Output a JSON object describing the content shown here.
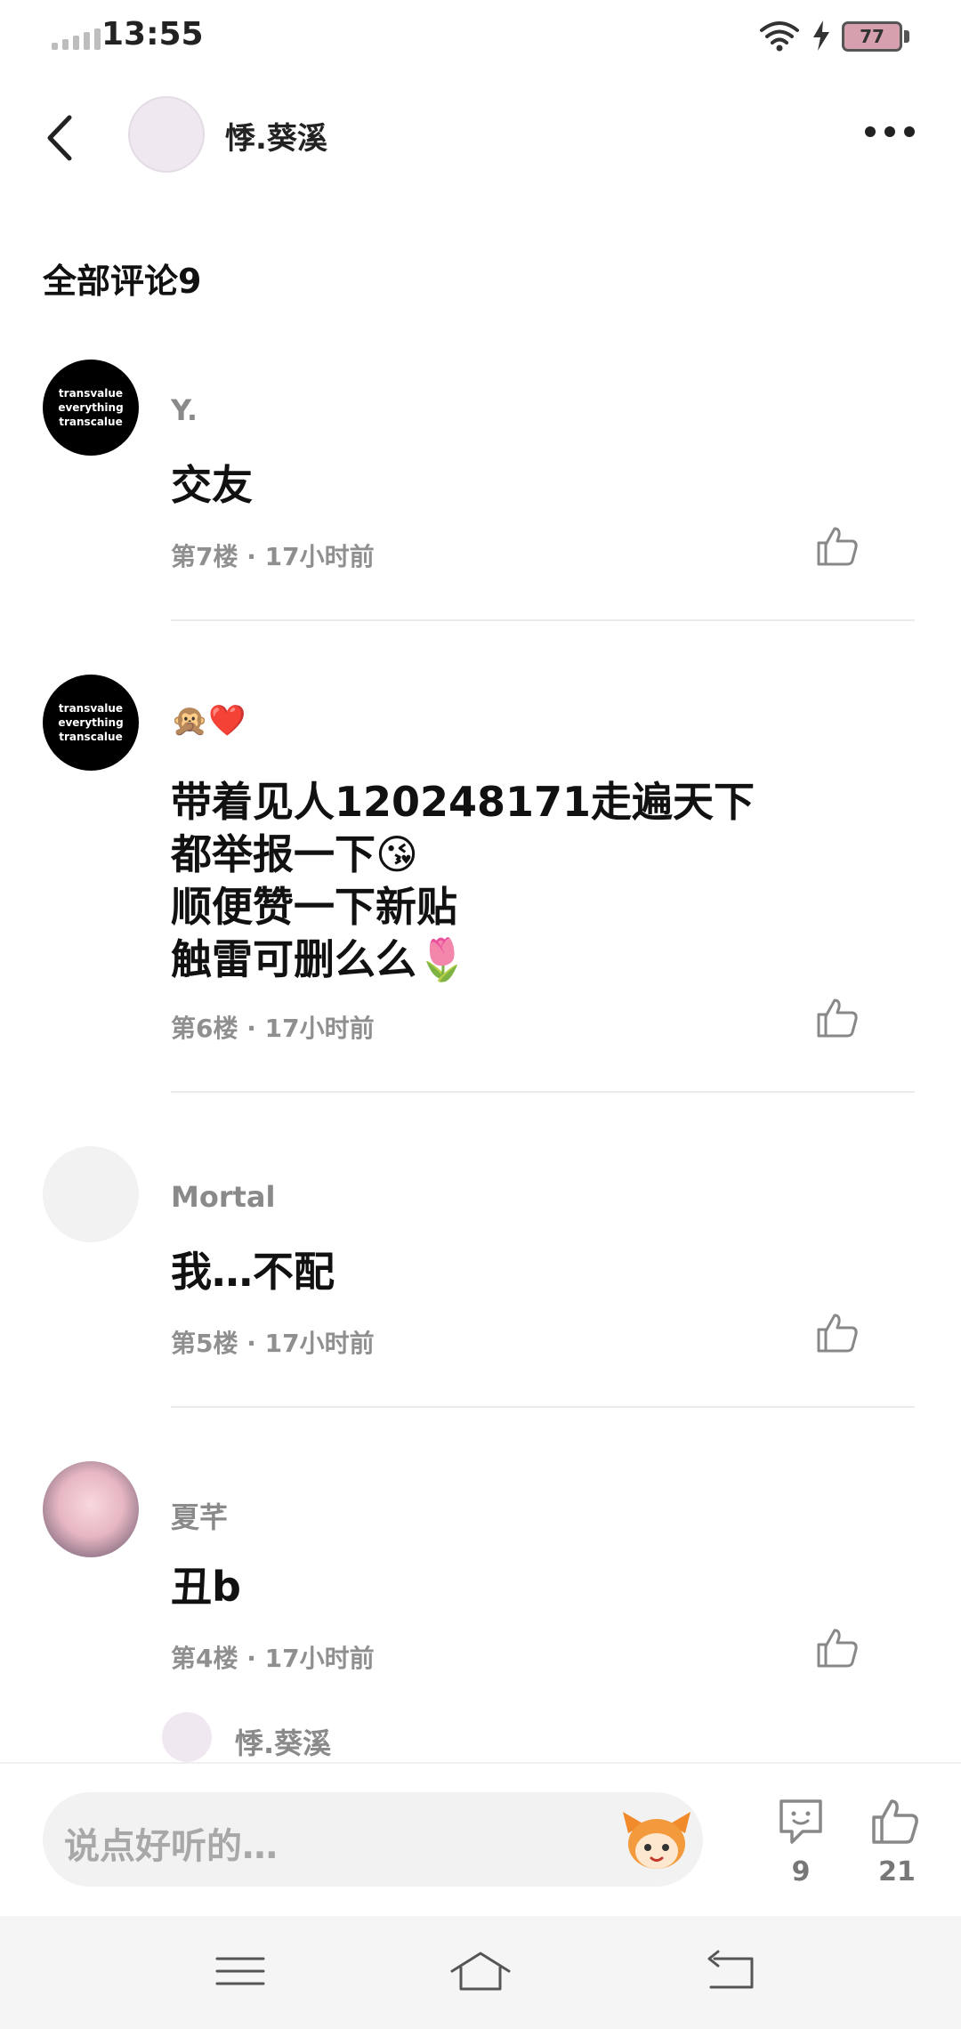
{
  "status_bar": {
    "time": "13:55",
    "battery": "77",
    "colors": {
      "battery_fill": "#d6a0ae"
    }
  },
  "header": {
    "title": "悸.葵溪",
    "back_icon": "chevron-left-icon",
    "more_icon": "more-dots-icon"
  },
  "section": {
    "title": "全部评论9"
  },
  "comments": [
    {
      "username": "Y.",
      "avatar_text": [
        "transvalue",
        "everything",
        "transcalue"
      ],
      "lines": [
        "交友"
      ],
      "meta": "第7楼 · 17小时前"
    },
    {
      "username": "🙊❤️",
      "avatar_text": [
        "transvalue",
        "everything",
        "transcalue"
      ],
      "lines": [
        "带着见人120248171走遍天下",
        "都举报一下😘",
        "顺便赞一下新贴",
        "触雷可删么么🌷"
      ],
      "meta": "第6楼 · 17小时前"
    },
    {
      "username": "Mortal",
      "lines": [
        "我…不配"
      ],
      "meta": "第5楼 · 17小时前"
    },
    {
      "username": "夏芊",
      "lines": [
        "丑b"
      ],
      "meta": "第4楼 · 17小时前"
    }
  ],
  "reply_preview": {
    "username": "悸.葵溪"
  },
  "bottom_bar": {
    "input_placeholder": "说点好听的…",
    "comment_count": "9",
    "like_count": "21"
  },
  "nav_bar": {
    "icons": [
      "menu-icon",
      "home-icon",
      "back-nav-icon"
    ]
  }
}
